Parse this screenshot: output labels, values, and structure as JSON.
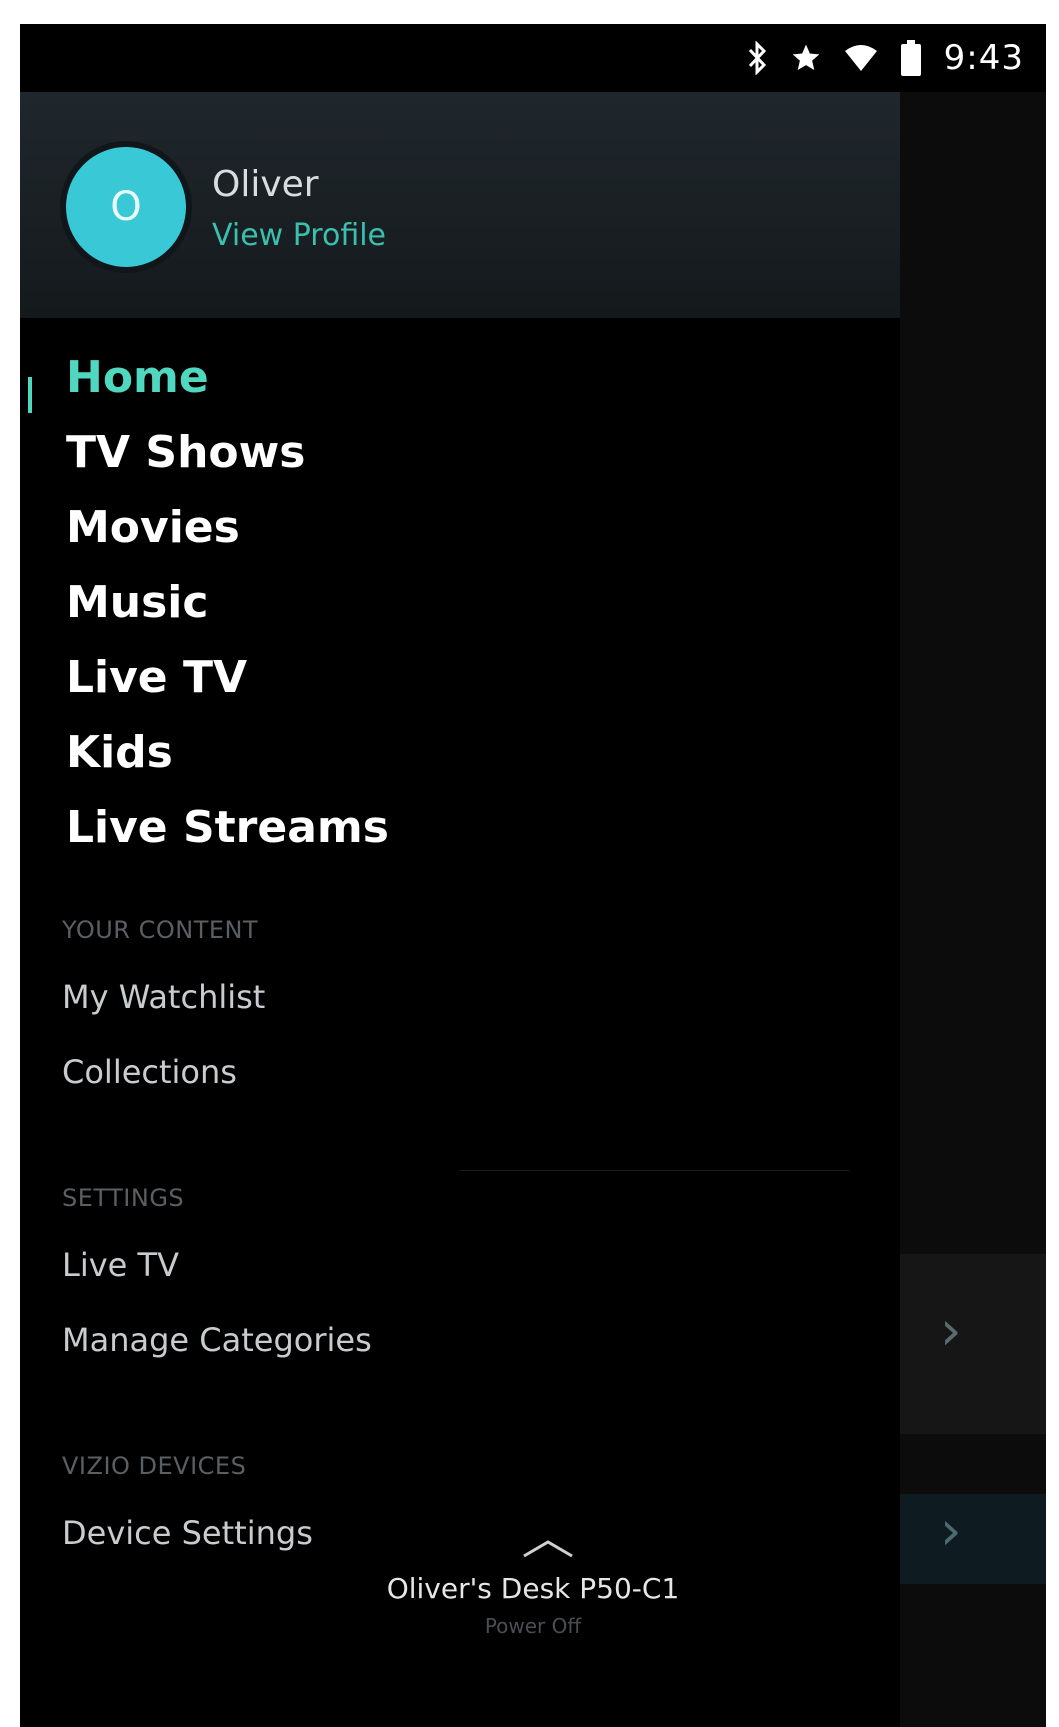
{
  "status_bar": {
    "icons": [
      "bluetooth-icon",
      "star-icon",
      "wifi-icon",
      "battery-icon"
    ],
    "time": "9:43"
  },
  "profile": {
    "initial": "O",
    "name": "Oliver",
    "link": "View Profile"
  },
  "nav": {
    "items": [
      {
        "label": "Home",
        "active": true
      },
      {
        "label": "TV Shows"
      },
      {
        "label": "Movies"
      },
      {
        "label": "Music"
      },
      {
        "label": "Live TV"
      },
      {
        "label": "Kids"
      },
      {
        "label": "Live Streams"
      }
    ]
  },
  "your_content": {
    "header": "YOUR CONTENT",
    "items": [
      "My Watchlist",
      "Collections"
    ]
  },
  "settings": {
    "header": "SETTINGS",
    "items": [
      "Live TV",
      "Manage Categories"
    ]
  },
  "vizio_devices": {
    "header": "VIZIO DEVICES",
    "items": [
      "Device Settings"
    ]
  },
  "device_footer": {
    "name": "Oliver's Desk P50-C1",
    "status": "Power Off"
  },
  "colors": {
    "accent": "#4fd8bf",
    "avatar": "#38c8d6",
    "background": "#000000"
  }
}
